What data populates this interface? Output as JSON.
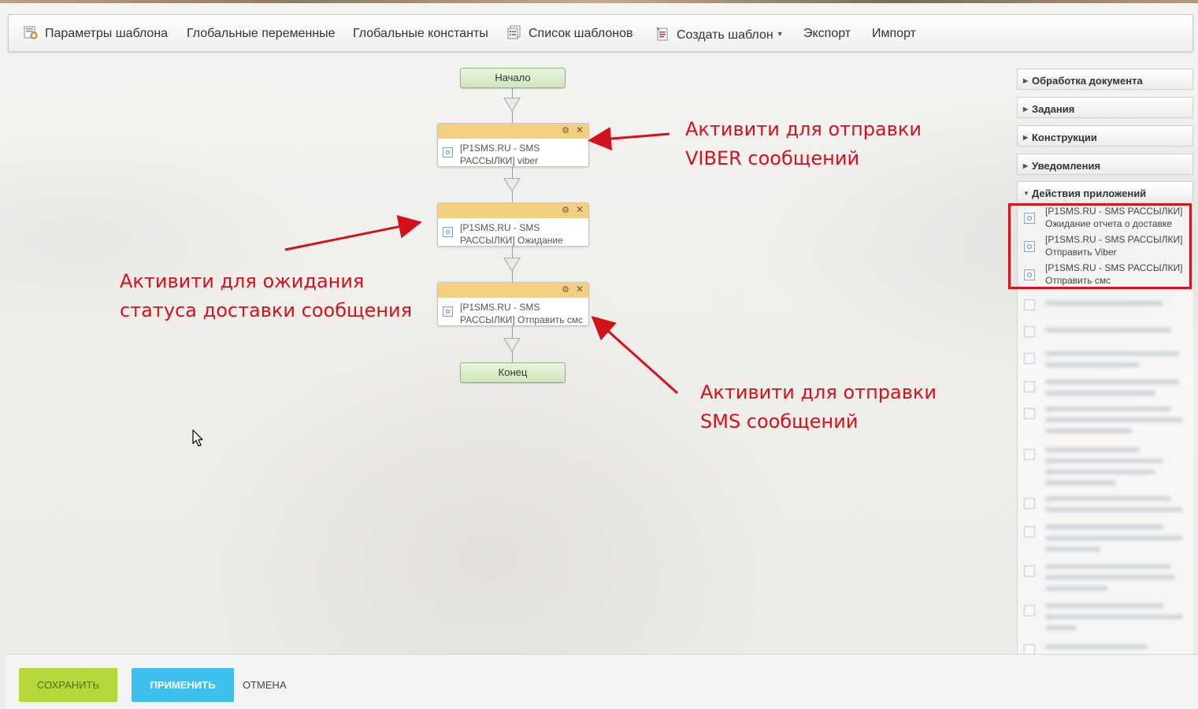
{
  "toolbar": {
    "items": [
      {
        "label": "Параметры шаблона",
        "icon": "template-params-icon"
      },
      {
        "label": "Глобальные переменные"
      },
      {
        "label": "Глобальные константы"
      },
      {
        "label": "Список шаблонов",
        "icon": "template-list-icon"
      },
      {
        "label": "Создать шаблон",
        "icon": "create-template-icon",
        "dropdown": true
      },
      {
        "label": "Экспорт"
      },
      {
        "label": "Импорт"
      }
    ]
  },
  "flow": {
    "start_label": "Начало",
    "end_label": "Конец",
    "activities": [
      {
        "line1": "[P1SMS.RU - SMS",
        "line2": "РАССЫЛКИ] viber"
      },
      {
        "line1": "[P1SMS.RU - SMS",
        "line2": "РАССЫЛКИ] Ожидание"
      },
      {
        "line1": "[P1SMS.RU - SMS",
        "line2": "РАССЫЛКИ] Отправить смс"
      }
    ]
  },
  "annotations": {
    "viber": {
      "line1": "Активити для отправки",
      "line2": "VIBER сообщений"
    },
    "wait": {
      "line1": "Активити для ожидания",
      "line2": "статуса доставки сообщения"
    },
    "sms": {
      "line1": "Активити для отправки",
      "line2": "SMS сообщений"
    },
    "color": "#d4121b"
  },
  "side_panel": {
    "sections": [
      {
        "label": "Обработка документа",
        "expanded": false
      },
      {
        "label": "Задания",
        "expanded": false
      },
      {
        "label": "Конструкции",
        "expanded": false
      },
      {
        "label": "Уведомления",
        "expanded": false
      },
      {
        "label": "Действия приложений",
        "expanded": true
      }
    ],
    "items": [
      {
        "line1": "[P1SMS.RU - SMS РАССЫЛКИ]",
        "line2": "Ожидание отчета о доставке"
      },
      {
        "line1": "[P1SMS.RU - SMS РАССЫЛКИ]",
        "line2": "Отправить Viber"
      },
      {
        "line1": "[P1SMS.RU - SMS РАССЫЛКИ]",
        "line2": "Отправить смс"
      }
    ]
  },
  "footer": {
    "save_label": "СОХРАНИТЬ",
    "apply_label": "ПРИМЕНИТЬ",
    "cancel_label": "ОТМЕНА"
  },
  "colors": {
    "save": "#b4d83a",
    "apply": "#3ec0ec",
    "activity_header": "#f4cf7f",
    "terminal": "#cfe6bd",
    "highlight": "#e0101a"
  }
}
